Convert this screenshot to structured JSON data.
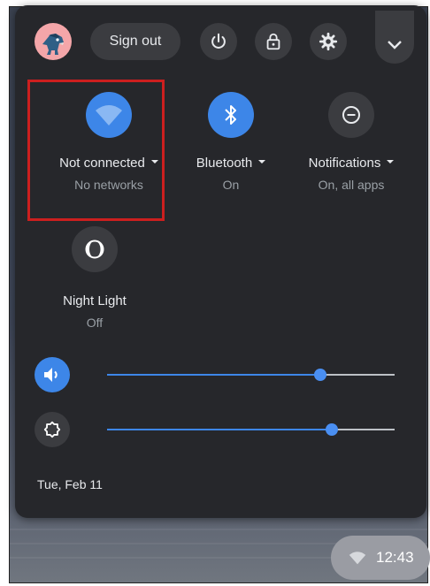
{
  "header": {
    "sign_out_label": "Sign out",
    "icons": [
      "avatar",
      "power-icon",
      "lock-icon",
      "gear-icon",
      "chevron-down-icon"
    ]
  },
  "features": [
    {
      "label": "Not connected",
      "sub": "No networks",
      "icon": "wifi-icon",
      "state": "on",
      "has_menu": true
    },
    {
      "label": "Bluetooth",
      "sub": "On",
      "icon": "bluetooth-icon",
      "state": "on",
      "has_menu": true
    },
    {
      "label": "Notifications",
      "sub": "On, all apps",
      "icon": "do-not-disturb-icon",
      "state": "off",
      "has_menu": true
    },
    {
      "label": "Night Light",
      "sub": "Off",
      "icon": "night-light-icon",
      "state": "off",
      "has_menu": false
    }
  ],
  "sliders": {
    "volume": {
      "icon": "volume-icon",
      "value_percent": 74
    },
    "brightness": {
      "icon": "brightness-icon",
      "value_percent": 78
    }
  },
  "date": "Tue, Feb 11",
  "tray": {
    "time": "12:43",
    "icon": "wifi-icon"
  },
  "colors": {
    "accent": "#3d86e8",
    "panel": "#26272b",
    "button": "#3b3c40",
    "highlight": "#cc1f1f"
  }
}
